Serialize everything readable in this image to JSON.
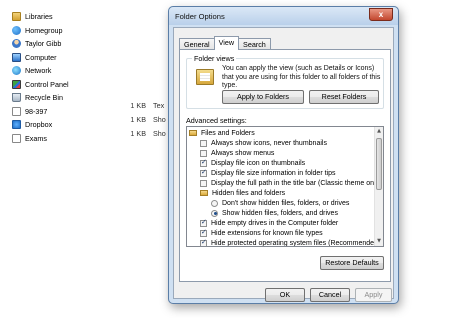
{
  "explorer": {
    "nav_items": [
      {
        "label": "Libraries",
        "icon": "libraries-icon"
      },
      {
        "label": "Homegroup",
        "icon": "homegroup-icon"
      },
      {
        "label": "Taylor Gibb",
        "icon": "user-icon"
      },
      {
        "label": "Computer",
        "icon": "computer-icon"
      },
      {
        "label": "Network",
        "icon": "network-icon"
      },
      {
        "label": "Control Panel",
        "icon": "control-panel-icon"
      },
      {
        "label": "Recycle Bin",
        "icon": "recycle-bin-icon"
      }
    ],
    "files": [
      {
        "name": "98-397",
        "size": "1 KB",
        "type": "Tex"
      },
      {
        "name": "Dropbox",
        "size": "1 KB",
        "type": "Sho"
      },
      {
        "name": "Exams",
        "size": "1 KB",
        "type": "Sho"
      }
    ]
  },
  "dialog": {
    "title": "Folder Options",
    "close_label": "x",
    "tabs": [
      "General",
      "View",
      "Search"
    ],
    "active_tab": "View",
    "folder_views": {
      "label": "Folder views",
      "description": "You can apply the view (such as Details or Icons) that you are using for this folder to all folders of this type.",
      "apply_button": "Apply to Folders",
      "reset_button": "Reset Folders"
    },
    "advanced_label": "Advanced settings:",
    "settings": [
      {
        "type": "folder",
        "label": "Files and Folders",
        "indent": 0
      },
      {
        "type": "checkbox",
        "label": "Always show icons, never thumbnails",
        "checked": false,
        "indent": 1
      },
      {
        "type": "checkbox",
        "label": "Always show menus",
        "checked": false,
        "indent": 1
      },
      {
        "type": "checkbox",
        "label": "Display file icon on thumbnails",
        "checked": true,
        "indent": 1
      },
      {
        "type": "checkbox",
        "label": "Display file size information in folder tips",
        "checked": true,
        "indent": 1
      },
      {
        "type": "checkbox",
        "label": "Display the full path in the title bar (Classic theme only)",
        "checked": false,
        "indent": 1
      },
      {
        "type": "folder",
        "label": "Hidden files and folders",
        "indent": 1
      },
      {
        "type": "radio",
        "label": "Don't show hidden files, folders, or drives",
        "checked": false,
        "indent": 2
      },
      {
        "type": "radio",
        "label": "Show hidden files, folders, and drives",
        "checked": true,
        "indent": 2
      },
      {
        "type": "checkbox",
        "label": "Hide empty drives in the Computer folder",
        "checked": true,
        "indent": 1
      },
      {
        "type": "checkbox",
        "label": "Hide extensions for known file types",
        "checked": true,
        "indent": 1
      },
      {
        "type": "checkbox",
        "label": "Hide protected operating system files (Recommended)",
        "checked": true,
        "indent": 1
      }
    ],
    "restore_button": "Restore Defaults",
    "ok_button": "OK",
    "cancel_button": "Cancel",
    "apply_button": "Apply"
  }
}
